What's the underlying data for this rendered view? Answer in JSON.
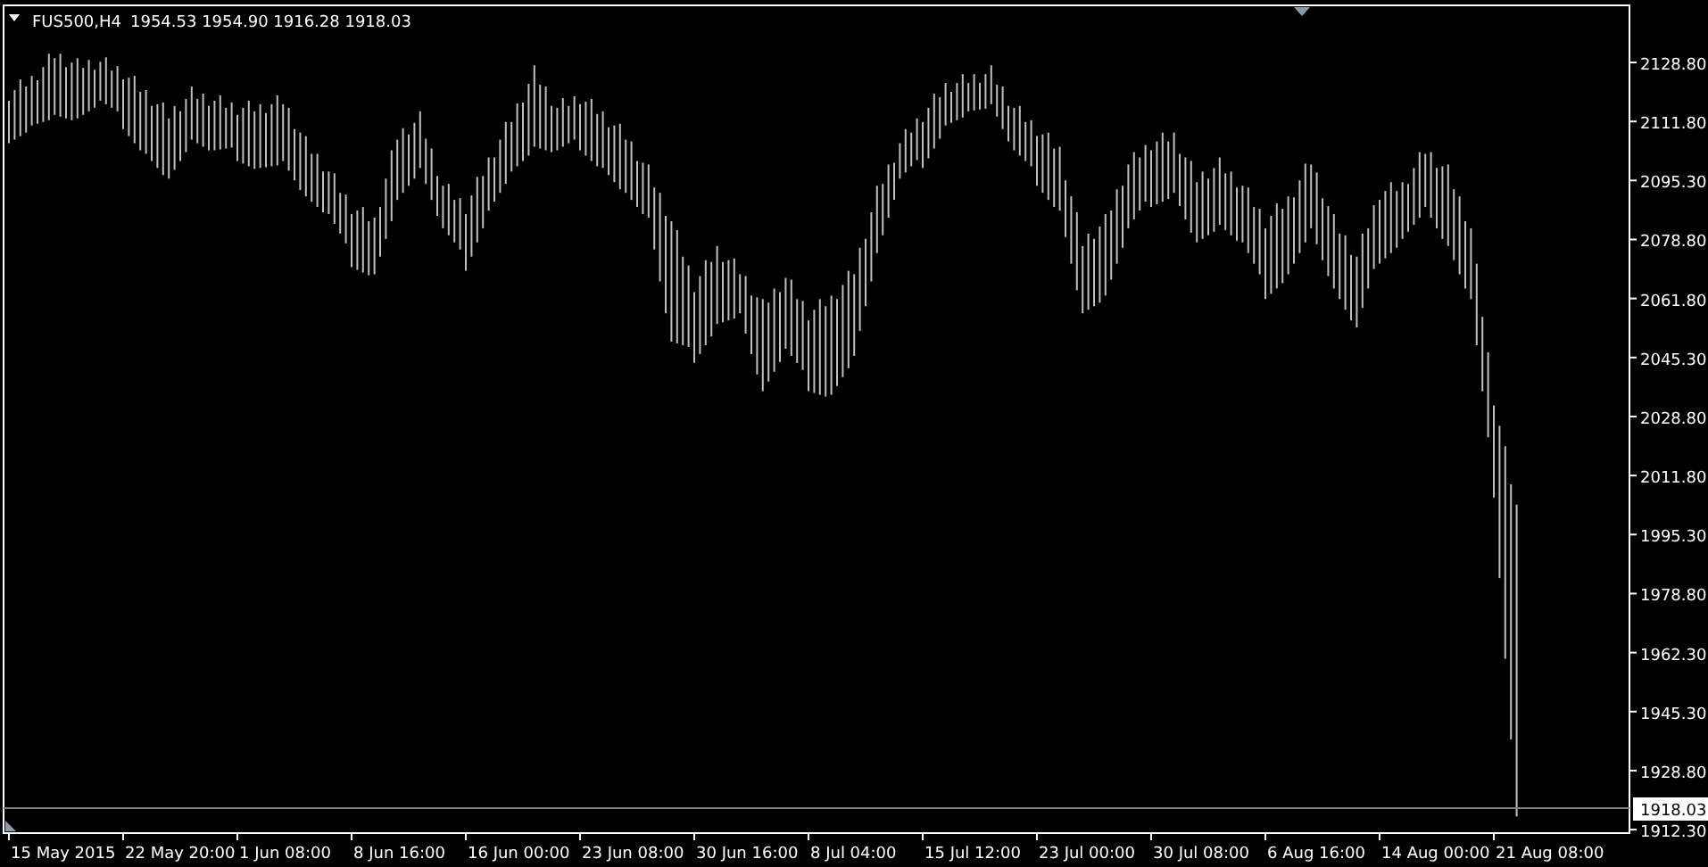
{
  "chart_header": {
    "symbol": "FUS500,H4",
    "ohlc": [
      "1954.53",
      "1954.90",
      "1916.28",
      "1918.03"
    ]
  },
  "current_price": "1918.03",
  "price_axis": [
    "2128.80",
    "2111.80",
    "2095.30",
    "2078.80",
    "2061.80",
    "2045.30",
    "2028.80",
    "2011.80",
    "1995.30",
    "1978.80",
    "1962.30",
    "1945.30",
    "1928.80",
    "1912.30"
  ],
  "time_axis": [
    "15 May 2015",
    "22 May 20:00",
    "1 Jun 08:00",
    "8 Jun 16:00",
    "16 Jun 00:00",
    "23 Jun 08:00",
    "30 Jun 16:00",
    "8 Jul 04:00",
    "15 Jul 12:00",
    "23 Jul 00:00",
    "30 Jul 08:00",
    "6 Aug 16:00",
    "14 Aug 00:00",
    "21 Aug 08:00"
  ]
}
